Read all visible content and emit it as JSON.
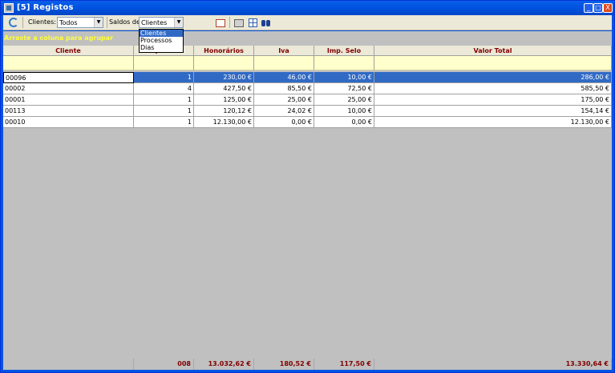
{
  "window": {
    "title": "[5] Registos",
    "buttons": [
      "_",
      "□",
      "X"
    ]
  },
  "toolbar": {
    "clientes_label": "Clientes:",
    "clientes_value": "Todos",
    "saldos_label": "Saldos de",
    "saldos_value": "Clientes",
    "saldos_options": [
      "Clientes",
      "Processos",
      "Dias"
    ]
  },
  "groupbar": {
    "text": "Arraste a coluna para agrupar"
  },
  "table": {
    "columns": [
      "Cliente",
      "Quant",
      "Honorários",
      "Iva",
      "Imp. Selo",
      "Valor Total"
    ],
    "rows": [
      [
        "00096",
        "1",
        "230,00 €",
        "46,00 €",
        "10,00 €",
        "286,00 €"
      ],
      [
        "00002",
        "4",
        "427,50 €",
        "85,50 €",
        "72,50 €",
        "585,50 €"
      ],
      [
        "00001",
        "1",
        "125,00 €",
        "25,00 €",
        "25,00 €",
        "175,00 €"
      ],
      [
        "00113",
        "1",
        "120,12 €",
        "24,02 €",
        "10,00 €",
        "154,14 €"
      ],
      [
        "00010",
        "1",
        "12.130,00 €",
        "0,00 €",
        "0,00 €",
        "12.130,00 €"
      ]
    ],
    "selected_row": 0
  },
  "totals": {
    "quant": "008",
    "honorarios": "13.032,62 €",
    "iva": "180,52 €",
    "imp_selo": "117,50 €",
    "valor_total": "13.330,64 €"
  },
  "colors": {
    "header_text": "#800000",
    "selection": "#316ac5",
    "group_text": "#ffff33",
    "filter_row": "#ffffcc"
  }
}
